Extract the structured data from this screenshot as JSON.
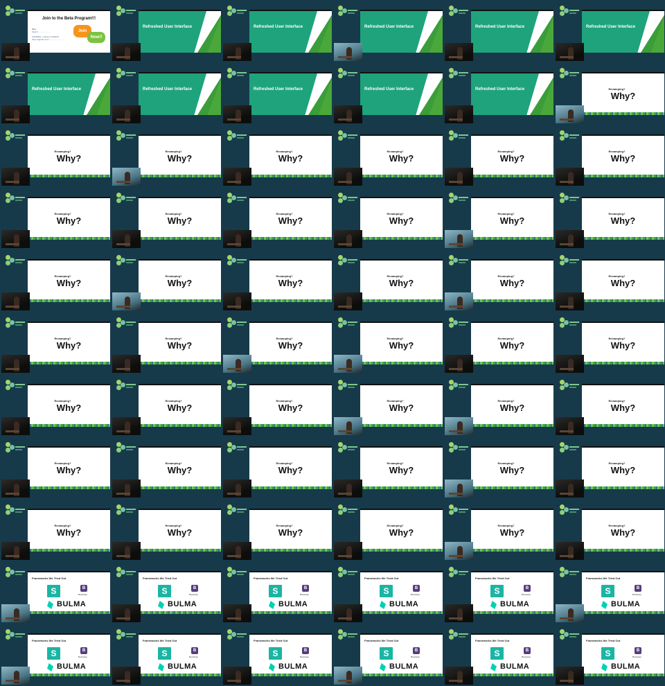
{
  "colors": {
    "background": "#173b4b",
    "teal": "#1fa37c",
    "green": "#3a9d3a",
    "orange": "#f7941d",
    "bulma": "#00d1b2",
    "bootstrap": "#563d7c"
  },
  "texts": {
    "join": {
      "title": "Join to the Beta Program!!!",
      "line1": "Blog:",
      "line2": "https://....................",
      "line3": "Feedback + issues to GitHub:",
      "line4": "https://github.com/............................",
      "btn1": "Join",
      "btn2": "Now!!"
    },
    "refreshed": {
      "title": "Refreshed User Interface"
    },
    "why": {
      "small": "Revamping?",
      "big": "Why?"
    },
    "frameworks": {
      "title": "Frameworks We Tried Out",
      "semantic_letter": "S",
      "bootstrap_letter": "B",
      "bootstrap_label": "Bootstrap",
      "bulma_label": "BULMA"
    }
  },
  "grid": {
    "columns": 6,
    "rows": 11,
    "cells": [
      {
        "slide": "join",
        "cam": "dark"
      },
      {
        "slide": "refreshed",
        "cam": "dark"
      },
      {
        "slide": "refreshed",
        "cam": "dark"
      },
      {
        "slide": "refreshed",
        "cam": "light"
      },
      {
        "slide": "refreshed",
        "cam": "dark"
      },
      {
        "slide": "refreshed",
        "cam": "dark"
      },
      {
        "slide": "refreshed",
        "cam": "dark"
      },
      {
        "slide": "refreshed",
        "cam": "dark"
      },
      {
        "slide": "refreshed",
        "cam": "dark"
      },
      {
        "slide": "refreshed",
        "cam": "dark"
      },
      {
        "slide": "refreshed",
        "cam": "dark"
      },
      {
        "slide": "why",
        "cam": "light"
      },
      {
        "slide": "why",
        "cam": "dark"
      },
      {
        "slide": "why",
        "cam": "light"
      },
      {
        "slide": "why",
        "cam": "dark"
      },
      {
        "slide": "why",
        "cam": "dark"
      },
      {
        "slide": "why",
        "cam": "dark"
      },
      {
        "slide": "why",
        "cam": "dark"
      },
      {
        "slide": "why",
        "cam": "dark"
      },
      {
        "slide": "why",
        "cam": "dark"
      },
      {
        "slide": "why",
        "cam": "dark"
      },
      {
        "slide": "why",
        "cam": "dark"
      },
      {
        "slide": "why",
        "cam": "light"
      },
      {
        "slide": "why",
        "cam": "dark"
      },
      {
        "slide": "why",
        "cam": "dark"
      },
      {
        "slide": "why",
        "cam": "light"
      },
      {
        "slide": "why",
        "cam": "dark"
      },
      {
        "slide": "why",
        "cam": "dark"
      },
      {
        "slide": "why",
        "cam": "light"
      },
      {
        "slide": "why",
        "cam": "dark"
      },
      {
        "slide": "why",
        "cam": "dark"
      },
      {
        "slide": "why",
        "cam": "dark"
      },
      {
        "slide": "why",
        "cam": "light"
      },
      {
        "slide": "why",
        "cam": "light"
      },
      {
        "slide": "why",
        "cam": "dark"
      },
      {
        "slide": "why",
        "cam": "dark"
      },
      {
        "slide": "why",
        "cam": "dark"
      },
      {
        "slide": "why",
        "cam": "dark"
      },
      {
        "slide": "why",
        "cam": "dark"
      },
      {
        "slide": "why",
        "cam": "light"
      },
      {
        "slide": "why",
        "cam": "light"
      },
      {
        "slide": "why",
        "cam": "dark"
      },
      {
        "slide": "why",
        "cam": "dark"
      },
      {
        "slide": "why",
        "cam": "dark"
      },
      {
        "slide": "why",
        "cam": "dark"
      },
      {
        "slide": "why",
        "cam": "dark"
      },
      {
        "slide": "why",
        "cam": "light"
      },
      {
        "slide": "why",
        "cam": "dark"
      },
      {
        "slide": "why",
        "cam": "dark"
      },
      {
        "slide": "why",
        "cam": "dark"
      },
      {
        "slide": "why",
        "cam": "dark"
      },
      {
        "slide": "why",
        "cam": "dark"
      },
      {
        "slide": "why",
        "cam": "light"
      },
      {
        "slide": "why",
        "cam": "dark"
      },
      {
        "slide": "frameworks",
        "cam": "light"
      },
      {
        "slide": "frameworks",
        "cam": "dark"
      },
      {
        "slide": "frameworks",
        "cam": "dark"
      },
      {
        "slide": "frameworks",
        "cam": "dark"
      },
      {
        "slide": "frameworks",
        "cam": "dark"
      },
      {
        "slide": "frameworks",
        "cam": "light"
      },
      {
        "slide": "frameworks",
        "cam": "light"
      },
      {
        "slide": "frameworks",
        "cam": "dark"
      },
      {
        "slide": "frameworks",
        "cam": "dark"
      },
      {
        "slide": "frameworks",
        "cam": "light"
      },
      {
        "slide": "frameworks",
        "cam": "dark"
      },
      {
        "slide": "frameworks",
        "cam": "dark"
      }
    ]
  }
}
